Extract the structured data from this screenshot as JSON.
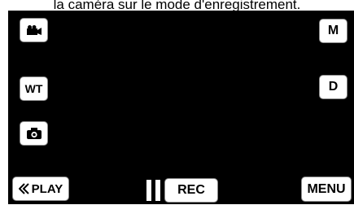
{
  "caption": "la caméra sur le mode d'enregistrement.",
  "buttons": {
    "movie_mode_icon": "movie-camera-icon",
    "manual": "M",
    "zoom": "WT",
    "display": "D",
    "still_mode_icon": "still-camera-icon",
    "playback": "PLAY",
    "pause_icon": "pause-icon",
    "record": "REC",
    "menu": "MENU"
  },
  "colors": {
    "screen_background": "#000000",
    "button_background": "#ffffff",
    "button_border": "#8c8c8c"
  }
}
